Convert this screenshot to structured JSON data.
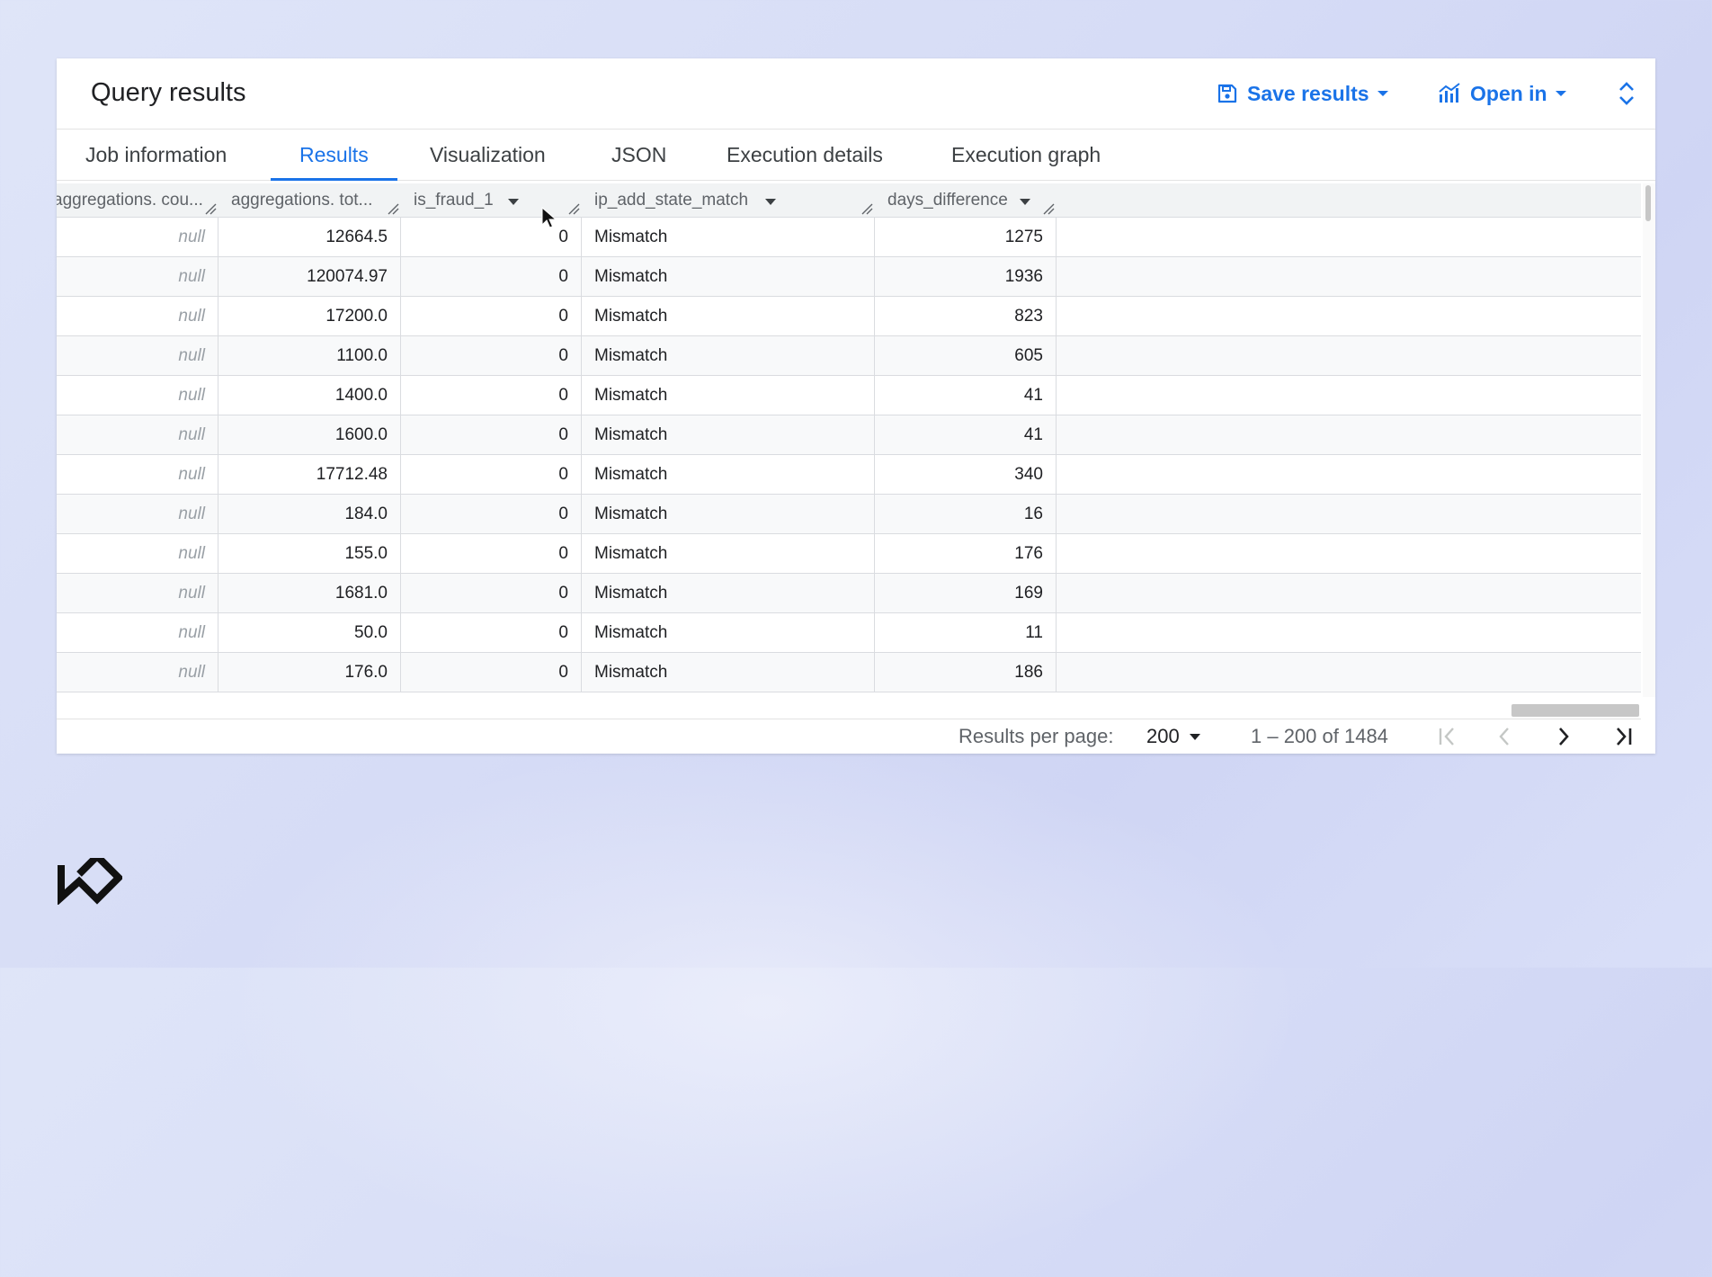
{
  "panel": {
    "title": "Query results",
    "save_label": "Save results",
    "open_label": "Open in"
  },
  "tabs": [
    {
      "label": "Job information"
    },
    {
      "label": "Results"
    },
    {
      "label": "Visualization"
    },
    {
      "label": "JSON"
    },
    {
      "label": "Execution details"
    },
    {
      "label": "Execution graph"
    }
  ],
  "table": {
    "columns": [
      {
        "label": "aggregations. cou..."
      },
      {
        "label": "aggregations. tot..."
      },
      {
        "label": "is_fraud_1"
      },
      {
        "label": "ip_add_state_match"
      },
      {
        "label": "days_difference"
      }
    ],
    "rows": [
      [
        "null",
        "12664.5",
        "0",
        "Mismatch",
        "1275"
      ],
      [
        "null",
        "120074.97",
        "0",
        "Mismatch",
        "1936"
      ],
      [
        "null",
        "17200.0",
        "0",
        "Mismatch",
        "823"
      ],
      [
        "null",
        "1100.0",
        "0",
        "Mismatch",
        "605"
      ],
      [
        "null",
        "1400.0",
        "0",
        "Mismatch",
        "41"
      ],
      [
        "null",
        "1600.0",
        "0",
        "Mismatch",
        "41"
      ],
      [
        "null",
        "17712.48",
        "0",
        "Mismatch",
        "340"
      ],
      [
        "null",
        "184.0",
        "0",
        "Mismatch",
        "16"
      ],
      [
        "null",
        "155.0",
        "0",
        "Mismatch",
        "176"
      ],
      [
        "null",
        "1681.0",
        "0",
        "Mismatch",
        "169"
      ],
      [
        "null",
        "50.0",
        "0",
        "Mismatch",
        "11"
      ],
      [
        "null",
        "176.0",
        "0",
        "Mismatch",
        "186"
      ]
    ]
  },
  "pagination": {
    "per_page_label": "Results per page:",
    "per_page_value": "200",
    "range": "1 – 200 of 1484"
  },
  "colors": {
    "accent": "#1a73e8"
  }
}
